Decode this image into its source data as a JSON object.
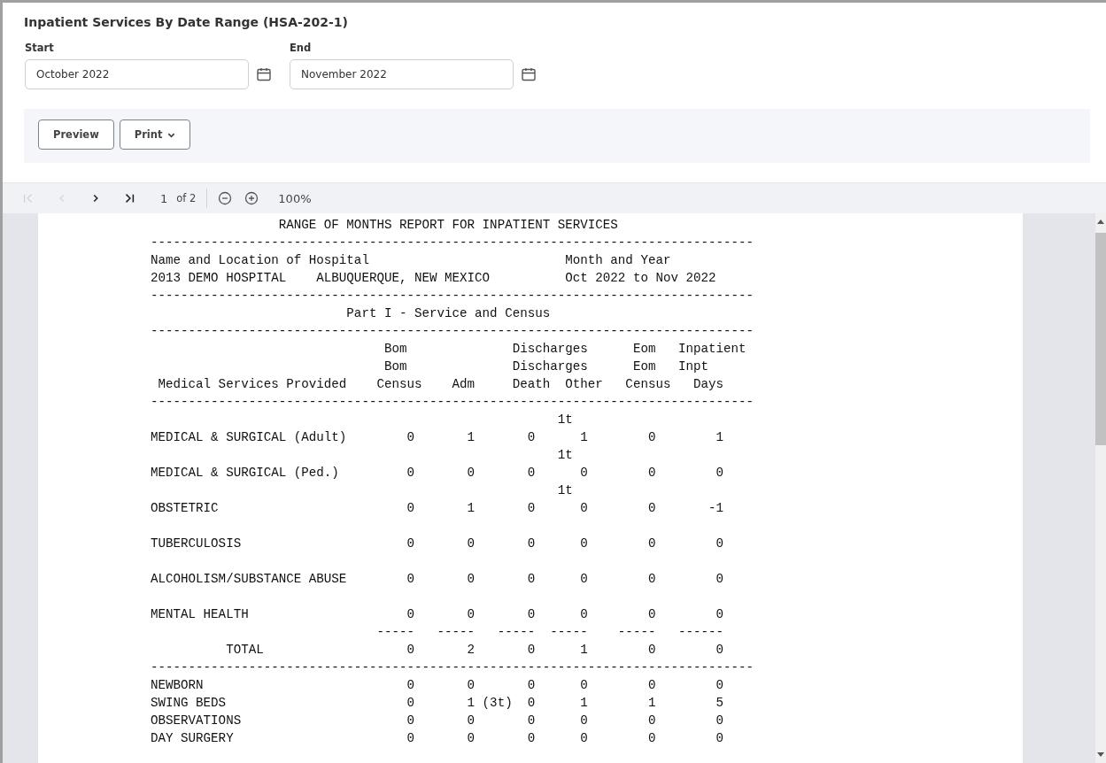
{
  "title": "Inpatient Services By Date Range (HSA-202-1)",
  "date_fields": [
    {
      "label": "Start",
      "value": "October 2022"
    },
    {
      "label": "End",
      "value": "November 2022"
    }
  ],
  "actions": [
    {
      "kind": "plain",
      "label": "Preview"
    },
    {
      "kind": "dropdown",
      "label": "Print"
    }
  ],
  "pager": {
    "buttons": [
      {
        "kind": "first",
        "disabled": true
      },
      {
        "kind": "prev",
        "disabled": true
      },
      {
        "kind": "next",
        "disabled": false
      },
      {
        "kind": "last",
        "disabled": false
      }
    ],
    "page": "1",
    "page_count": "of 2",
    "zoom": "100%"
  },
  "report": [
    {
      "kind": "line",
      "text": "                 RANGE OF MONTHS REPORT FOR INPATIENT SERVICES"
    },
    {
      "kind": "line",
      "text": "--------------------------------------------------------------------------------"
    },
    {
      "kind": "line",
      "text": "Name and Location of Hospital                          Month and Year"
    },
    {
      "kind": "line",
      "text": "2013 DEMO HOSPITAL    ALBUQUERQUE, NEW MEXICO          Oct 2022 to Nov 2022"
    },
    {
      "kind": "line",
      "text": "--------------------------------------------------------------------------------"
    },
    {
      "kind": "line",
      "text": "                          Part I - Service and Census"
    },
    {
      "kind": "line",
      "text": "--------------------------------------------------------------------------------"
    },
    {
      "kind": "line",
      "text": "                               Bom              Discharges      Eom   Inpatient"
    },
    {
      "kind": "line",
      "text": "                               Bom              Discharges      Eom   Inpt"
    },
    {
      "kind": "line",
      "text": " Medical Services Provided    Census    Adm     Death  Other   Census   Days"
    },
    {
      "kind": "line",
      "text": "--------------------------------------------------------------------------------"
    },
    {
      "kind": "service",
      "note": "                                                      1t",
      "text": "MEDICAL & SURGICAL (Adult)        0       1       0      1        0        1"
    },
    {
      "kind": "service",
      "note": "                                                      1t",
      "text": "MEDICAL & SURGICAL (Ped.)         0       0       0      0        0        0"
    },
    {
      "kind": "service",
      "note": "                                                      1t",
      "text": "OBSTETRIC                         0       1       0      0        0       -1"
    },
    {
      "kind": "service",
      "text": "TUBERCULOSIS                      0       0       0      0        0        0"
    },
    {
      "kind": "service",
      "text": "ALCOHOLISM/SUBSTANCE ABUSE        0       0       0      0        0        0"
    },
    {
      "kind": "service",
      "text": "MENTAL HEALTH                     0       0       0      0        0        0"
    },
    {
      "kind": "line",
      "text": "                              -----   -----   -----  -----    -----   ------"
    },
    {
      "kind": "line",
      "text": "          TOTAL                   0       2       0      1        0        0"
    },
    {
      "kind": "line",
      "text": "--------------------------------------------------------------------------------"
    },
    {
      "kind": "line",
      "text": "NEWBORN                           0       0       0      0        0        0"
    },
    {
      "kind": "line",
      "text": "SWING BEDS                        0       1 (3t)  0      1        1        5"
    },
    {
      "kind": "line",
      "text": "OBSERVATIONS                      0       0       0      0        0        0"
    },
    {
      "kind": "line",
      "text": "DAY SURGERY                       0       0       0      0        0        0"
    }
  ]
}
